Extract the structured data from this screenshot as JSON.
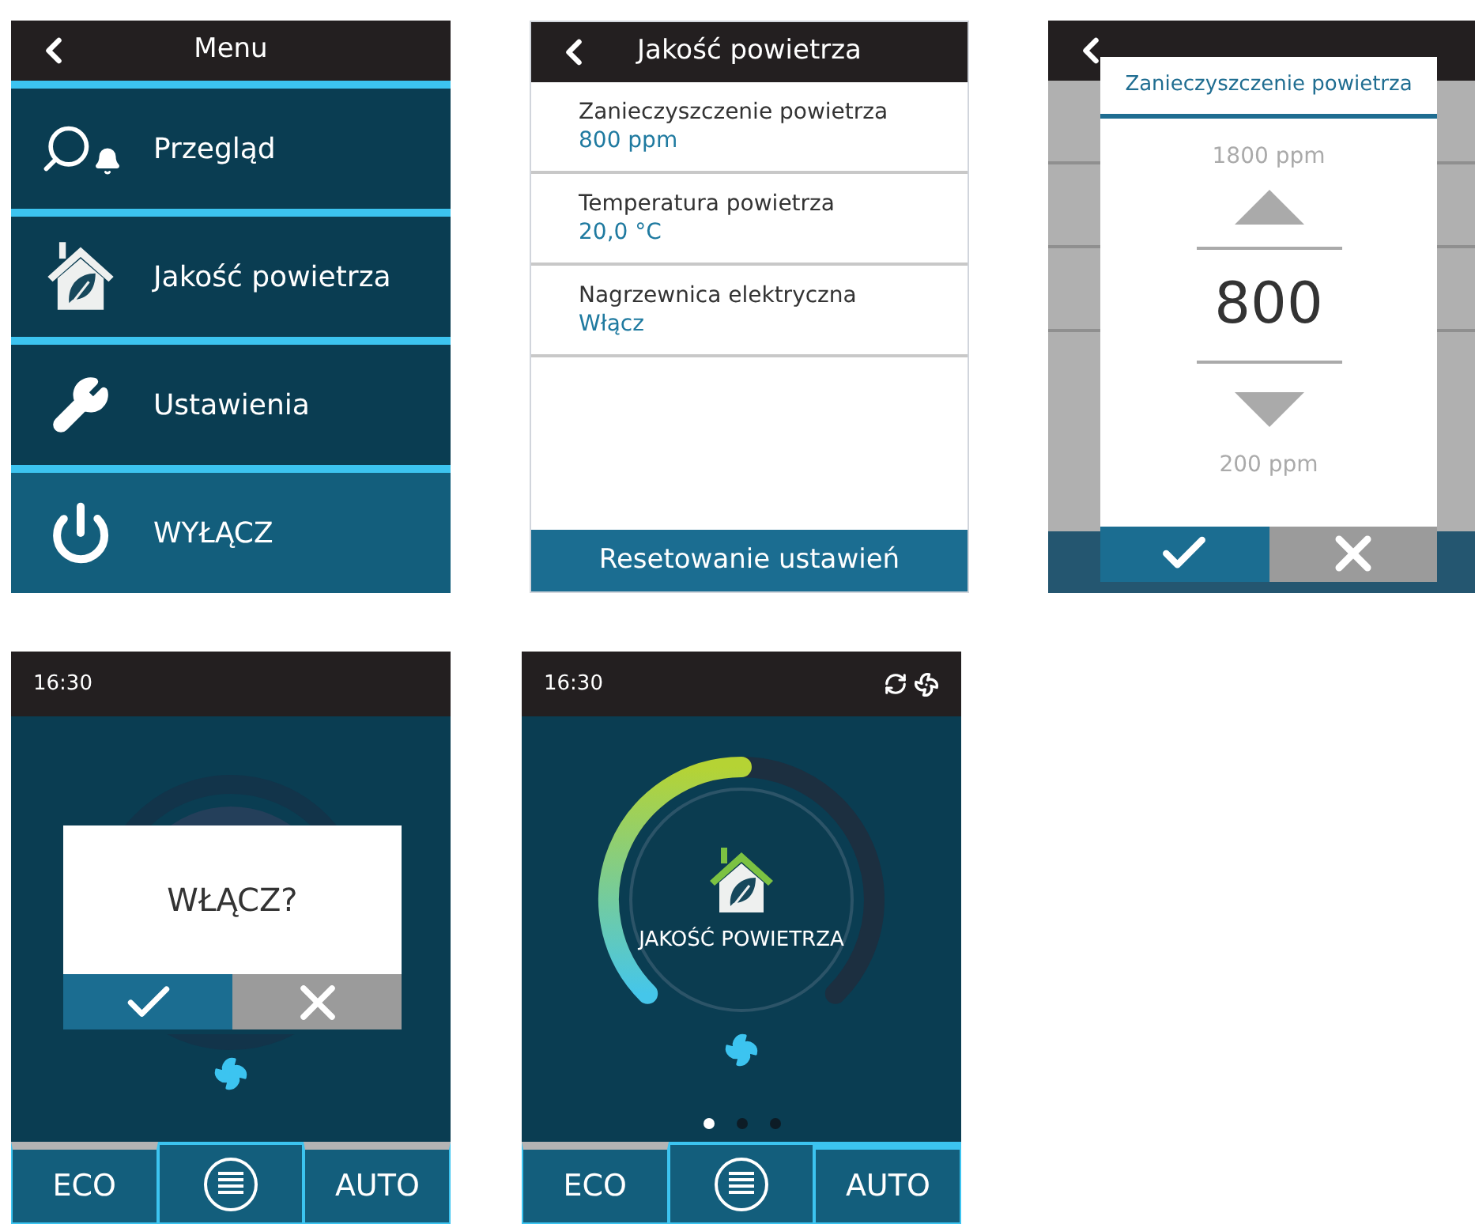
{
  "screens": [
    {
      "kind": "menu",
      "title": "Menu",
      "items": [
        {
          "label": "Przegląd",
          "selected": false
        },
        {
          "label": "Jakość powietrza",
          "selected": false
        },
        {
          "label": "Ustawienia",
          "selected": false
        },
        {
          "label": "WYŁĄCZ",
          "selected": true
        }
      ]
    },
    {
      "kind": "list",
      "title": "Jakość powietrza",
      "rows": [
        {
          "label": "Zanieczyszczenie powietrza",
          "value": "800 ppm"
        },
        {
          "label": "Temperatura powietrza",
          "value": "20,0 °C"
        },
        {
          "label": "Nagrzewnica elektryczna",
          "value": "Włącz"
        }
      ],
      "footer": "Resetowanie ustawień"
    },
    {
      "kind": "picker",
      "dialog": {
        "title": "Zanieczyszczenie powietrza",
        "upper": "1800 ppm",
        "value": "800",
        "lower": "200 ppm"
      }
    },
    {
      "kind": "confirm",
      "time": "16:30",
      "question": "WŁĄCZ?",
      "bottom": [
        {
          "kind": "text",
          "label": "ECO",
          "active": false
        },
        {
          "kind": "menu"
        },
        {
          "kind": "text",
          "label": "AUTO",
          "active": false
        }
      ]
    },
    {
      "kind": "home",
      "time": "16:30",
      "gauge": {
        "level": 0.5,
        "label": "JAKOŚĆ POWIETRZA"
      },
      "pages": [
        {
          "selected": true
        },
        {
          "selected": false
        },
        {
          "selected": false
        }
      ],
      "bottom": [
        {
          "kind": "text",
          "label": "ECO",
          "active": false
        },
        {
          "kind": "menu"
        },
        {
          "kind": "text",
          "label": "AUTO",
          "active": true
        }
      ]
    }
  ]
}
